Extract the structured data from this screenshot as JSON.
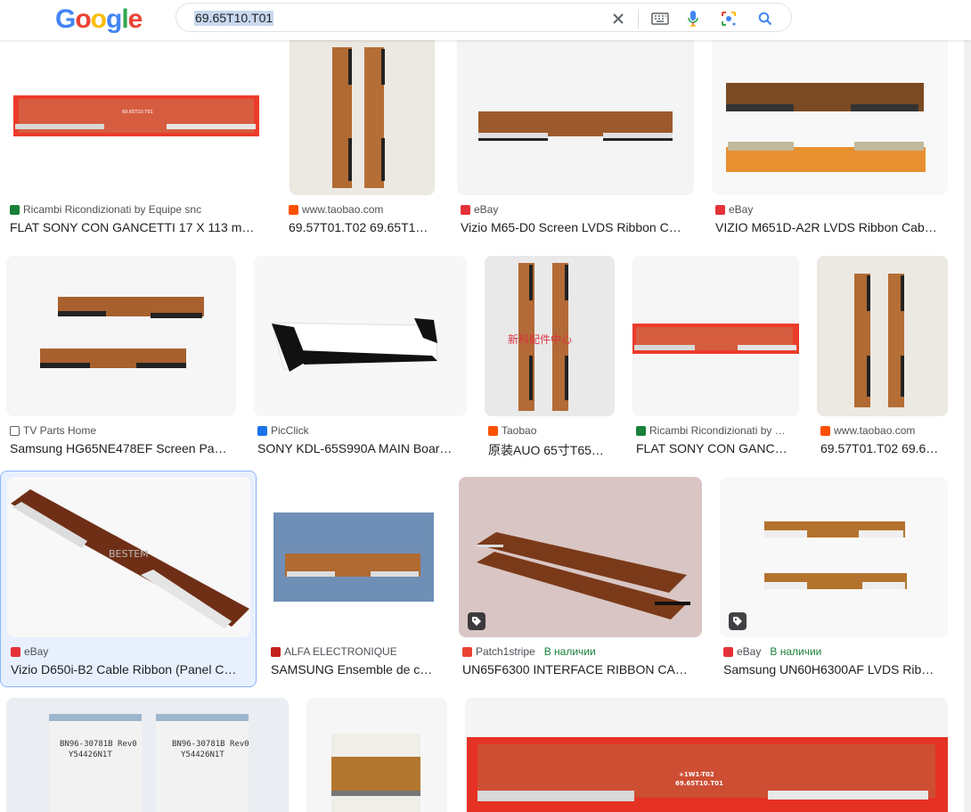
{
  "brand": {
    "logo_letters": [
      "G",
      "o",
      "o",
      "g",
      "l",
      "e"
    ],
    "logo_colors": [
      "#4285F4",
      "#EA4335",
      "#FBBC05",
      "#4285F4",
      "#34A853",
      "#EA4335"
    ]
  },
  "search": {
    "query": "69.65T10.T01"
  },
  "icons": {
    "clear": "close-icon",
    "keyboard": "keyboard-icon",
    "voice": "mic-icon",
    "lens": "lens-icon",
    "search": "search-icon"
  },
  "results": [
    {
      "source": "Ricambi Ricondizionati by Equipe snc",
      "title": "FLAT SONY CON GANCETTI 17 X 113 m…",
      "fav_color": "#188038"
    },
    {
      "source": "www.taobao.com",
      "title": "69.57T01.T02 69.65T1…",
      "fav_color": "#ff5000"
    },
    {
      "source": "eBay",
      "title": "Vizio M65-D0 Screen LVDS Ribbon C…",
      "fav_color": "#e53238"
    },
    {
      "source": "eBay",
      "title": "VIZIO M651D-A2R LVDS Ribbon Cab…",
      "fav_color": "#e53238"
    },
    {
      "source": "TV Parts Home",
      "title": "Samsung HG65NE478EF Screen Pa…",
      "fav_color": "#5f6368"
    },
    {
      "source": "PicClick",
      "title": "SONY KDL-65S990A MAIN Boar…",
      "fav_color": "#1a73e8"
    },
    {
      "source": "Taobao",
      "title": "原装AUO 65寸T65…",
      "fav_color": "#ff5000"
    },
    {
      "source": "Ricambi Ricondizionati by …",
      "title": "FLAT SONY CON GANC…",
      "fav_color": "#188038"
    },
    {
      "source": "www.taobao.com",
      "title": "69.57T01.T02 69.6…",
      "fav_color": "#ff5000"
    },
    {
      "source": "eBay",
      "title": "Vizio D650i-B2 Cable Ribbon (Panel C…",
      "fav_color": "#e53238"
    },
    {
      "source": "ALFA ELECTRONIQUE",
      "title": "SAMSUNG Ensemble de c…",
      "fav_color": "#c5221f"
    },
    {
      "source": "Patch1stripe",
      "stock": "В наличии",
      "title": "UN65F6300 INTERFACE RIBBON CA…",
      "fav_color": "#ea4335"
    },
    {
      "source": "eBay",
      "stock": "В наличии",
      "title": "Samsung UN60H6300AF LVDS Rib…",
      "fav_color": "#e53238"
    }
  ],
  "thumbnail_labels": {
    "r1c1": "69.65T10.T01",
    "r2c3": "新科配件中心",
    "r3c1": "BESTEM",
    "r4c1a": "BN96-30781B Rev0",
    "r4c1b": "Y54426N1T",
    "r4c3a": "+1W1-T02",
    "r4c3b": "69.65T10.T01"
  }
}
